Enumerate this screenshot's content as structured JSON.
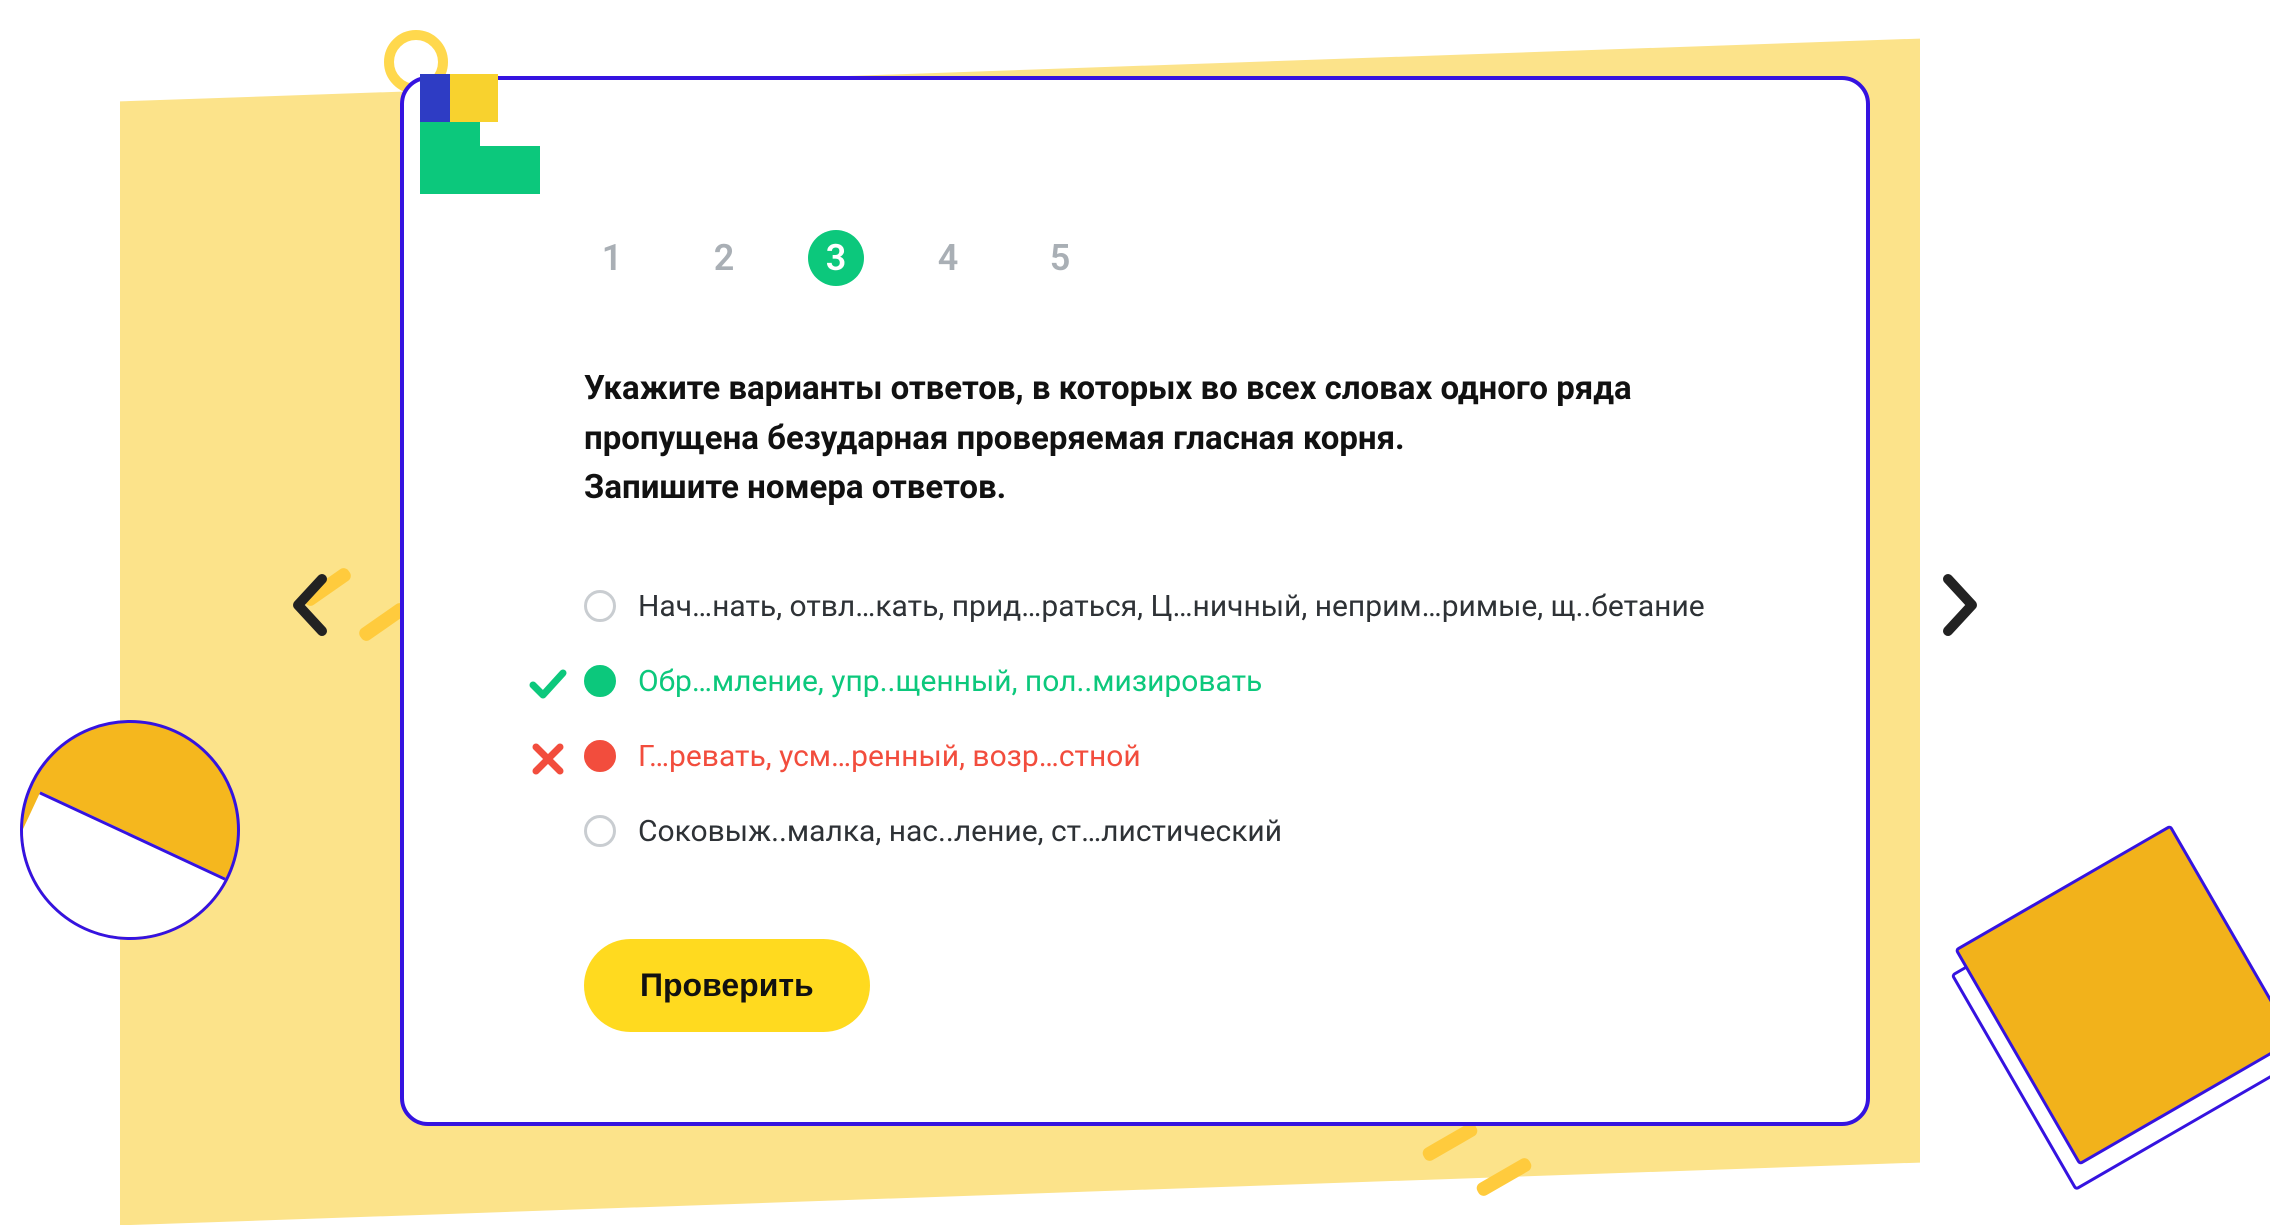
{
  "colors": {
    "accent_purple": "#3513e0",
    "accent_green": "#0CC87C",
    "accent_red": "#F24D3D",
    "accent_yellow": "#FFDA1F"
  },
  "steps": {
    "labels": [
      "1",
      "2",
      "3",
      "4",
      "5"
    ],
    "active_index": 2
  },
  "question": {
    "line1": "Укажите варианты ответов, в которых во всех словах одного ряда",
    "line2": "пропущена безударная проверяемая гласная корня.",
    "line3": "Запишите номера ответов."
  },
  "options": [
    {
      "text": "Нач…нать,  отвл…кать, прид…раться, Ц…ничный, неприм…римые, щ..бетание",
      "state": "plain"
    },
    {
      "text": "Обр…мление, упр..щенный, пол..мизировать",
      "state": "correct"
    },
    {
      "text": "Г…ревать, усм…ренный, возр…стной",
      "state": "wrong"
    },
    {
      "text": "Соковыж..малка, нас..ление, ст…листический",
      "state": "plain"
    }
  ],
  "check_label": "Проверить"
}
